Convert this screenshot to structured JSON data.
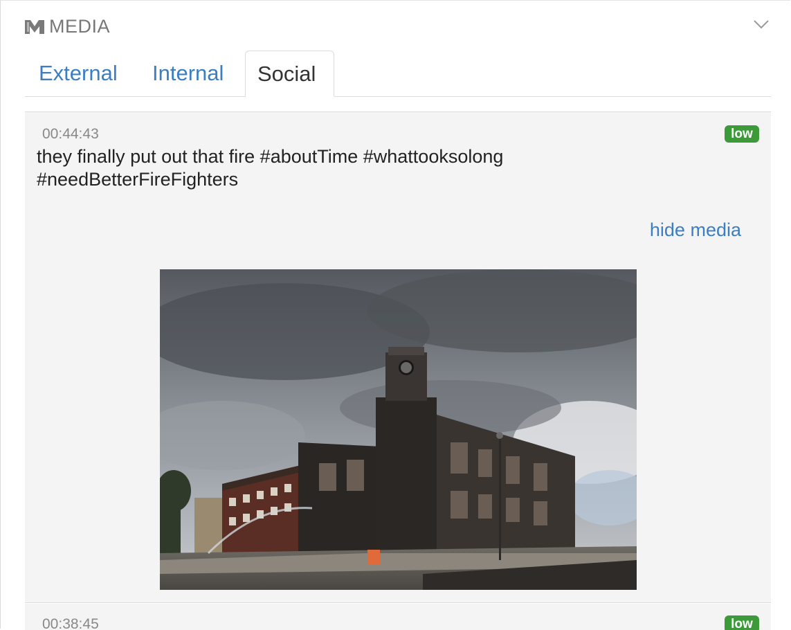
{
  "panel": {
    "title": "MEDIA",
    "icon": "media-logo-icon",
    "collapse_icon": "chevron-down-icon"
  },
  "tabs": [
    {
      "label": "External",
      "active": false
    },
    {
      "label": "Internal",
      "active": false
    },
    {
      "label": "Social",
      "active": true
    }
  ],
  "colors": {
    "link": "#3b7ec2",
    "badge_low": "#3c9a38",
    "post_background": "#f4f4f4"
  },
  "posts": [
    {
      "timestamp": "00:44:43",
      "priority": "low",
      "text": "they finally put out that fire #aboutTime #whattooksolong #needBetterFireFighters",
      "media_toggle_label": "hide media",
      "media": {
        "type": "photo",
        "subject": "burned-out building with clock tower"
      }
    },
    {
      "timestamp": "00:38:45",
      "priority": "low"
    }
  ]
}
